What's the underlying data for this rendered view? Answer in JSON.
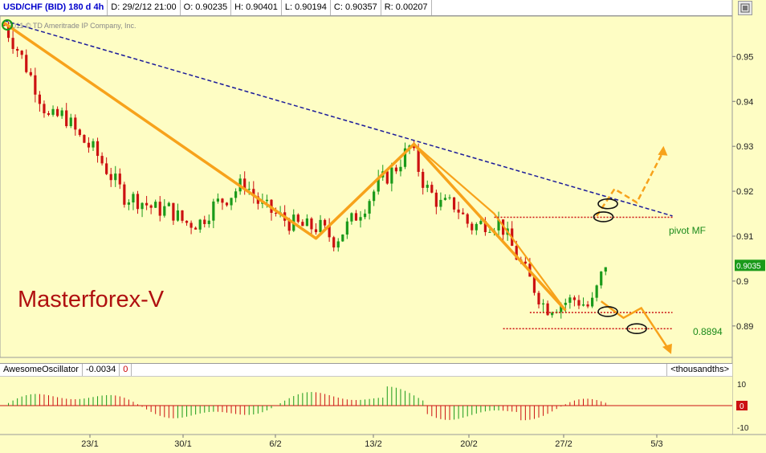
{
  "infobar": {
    "symbol": "USD/CHF (BID) 180 d 4h",
    "date": "D: 29/2/12 21:00",
    "open": "O: 0.90235",
    "high": "H: 0.90401",
    "low": "L: 0.90194",
    "close": "C: 0.90357",
    "range": "R: 0.00207"
  },
  "copyright": "2011 © TD Ameritrade IP Company, Inc.",
  "watermark": "Masterforex-V",
  "annotations": {
    "pivot_label": "pivot MF",
    "level_label": "0.8894"
  },
  "current_price": "0.9035",
  "oscillator": {
    "name": "AwesomeOscillator",
    "value": "-0.0034",
    "zero": "0",
    "units": "<thousandths>",
    "current_tag": "0",
    "ticks": [
      "10",
      "-10"
    ]
  },
  "colors": {
    "background": "#fefdc4",
    "up_candle": "#1a9a1a",
    "down_candle": "#cc1111",
    "trend_orange": "#f7a21b",
    "resistance_blue": "#1a1a9a",
    "level_red": "#cc1111",
    "watermark_red": "#b01010",
    "label_green": "#1a8a1a"
  },
  "chart_data": {
    "type": "candlestick",
    "price_ylim": [
      0.883,
      0.959
    ],
    "y_ticks": [
      "0.95",
      "0.94",
      "0.93",
      "0.92",
      "0.91",
      "0.9",
      "0.89"
    ],
    "x_ticks": [
      "23/1",
      "30/1",
      "6/2",
      "13/2",
      "20/2",
      "27/2",
      "5/3"
    ],
    "anchors": [
      0.957,
      0.951,
      0.944,
      0.936,
      0.937,
      0.932,
      0.929,
      0.924,
      0.919,
      0.918,
      0.916,
      0.916,
      0.913,
      0.913,
      0.917,
      0.919,
      0.922,
      0.917,
      0.915,
      0.913,
      0.912,
      0.912,
      0.909,
      0.913,
      0.917,
      0.922,
      0.925,
      0.93,
      0.921,
      0.917,
      0.917,
      0.912,
      0.913,
      0.913,
      0.906,
      0.9,
      0.894,
      0.895,
      0.896,
      0.894,
      0.904
    ],
    "x_range_candles": [
      0,
      136
    ],
    "forecast_candles": [
      136,
      158
    ],
    "trendlines": {
      "orange_zigzag": [
        [
          0,
          0.9575
        ],
        [
          70,
          0.9095
        ],
        [
          92,
          0.9305
        ],
        [
          126,
          0.8935
        ]
      ],
      "orange_from_peak": [
        [
          92,
          0.9305
        ],
        [
          110,
          0.915
        ],
        [
          126,
          0.8935
        ]
      ],
      "blue_resistance": [
        [
          0,
          0.958
        ],
        [
          150,
          0.9145
        ]
      ],
      "pivot_level": [
        [
          110,
          0.9142
        ],
        [
          150,
          0.9142
        ]
      ],
      "lower_level_1": [
        [
          118,
          0.893
        ],
        [
          150,
          0.893
        ]
      ],
      "lower_level_2": [
        [
          112,
          0.8894
        ],
        [
          150,
          0.8894
        ]
      ],
      "forecast_up": [
        [
          133,
          0.9145
        ],
        [
          137,
          0.9205
        ],
        [
          142,
          0.9175
        ],
        [
          148,
          0.929
        ]
      ],
      "forecast_down": [
        [
          134,
          0.8955
        ],
        [
          139,
          0.8918
        ],
        [
          143,
          0.894
        ],
        [
          149,
          0.885
        ]
      ]
    }
  }
}
